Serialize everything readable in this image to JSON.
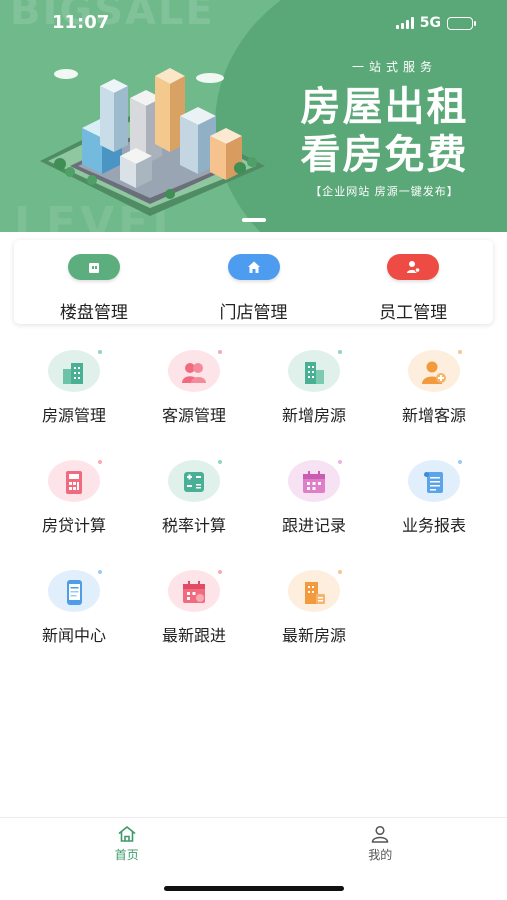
{
  "status_bar": {
    "time": "11:07",
    "network": "5G"
  },
  "banner": {
    "watermark_top": "BIGSALE",
    "watermark_bottom": "LEVEL",
    "subtitle": "一站式服务",
    "title_line1": "房屋出租",
    "title_line2": "看房免费",
    "footer": "【企业网站 房源一键发布】",
    "colors": {
      "bg": "#6fb98b",
      "circle": "#5aa877"
    }
  },
  "top_menu": [
    {
      "label": "楼盘管理",
      "icon": "building-icon",
      "color": "#5cae7e"
    },
    {
      "label": "门店管理",
      "icon": "house-icon",
      "color": "#4e9cf0"
    },
    {
      "label": "员工管理",
      "icon": "employee-icon",
      "color": "#ee4b45"
    }
  ],
  "grid": [
    {
      "label": "房源管理",
      "icon": "buildings-icon"
    },
    {
      "label": "客源管理",
      "icon": "customers-icon"
    },
    {
      "label": "新增房源",
      "icon": "add-building-icon"
    },
    {
      "label": "新增客源",
      "icon": "add-customer-icon"
    },
    {
      "label": "房贷计算",
      "icon": "mortgage-calculator-icon"
    },
    {
      "label": "税率计算",
      "icon": "tax-calculator-icon"
    },
    {
      "label": "跟进记录",
      "icon": "follow-up-calendar-icon"
    },
    {
      "label": "业务报表",
      "icon": "report-scroll-icon"
    },
    {
      "label": "新闻中心",
      "icon": "news-phone-icon"
    },
    {
      "label": "最新跟进",
      "icon": "latest-followup-icon"
    },
    {
      "label": "最新房源",
      "icon": "latest-listing-icon"
    }
  ],
  "tabbar": {
    "items": [
      {
        "label": "首页",
        "icon": "home-icon",
        "active": true
      },
      {
        "label": "我的",
        "icon": "profile-icon",
        "active": false
      }
    ],
    "active_color": "#3c9a6a"
  }
}
